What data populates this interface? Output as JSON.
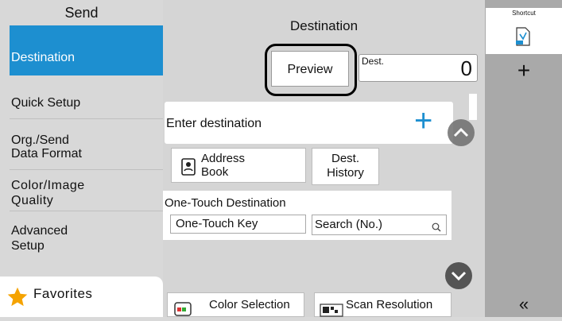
{
  "sidebar": {
    "title": "Send",
    "items": [
      {
        "label": "Destination"
      },
      {
        "label": "Quick Setup"
      },
      {
        "label": "Org./Send\nData Format"
      },
      {
        "label": "Color/Image\nQuality"
      },
      {
        "label": "Advanced\nSetup"
      }
    ],
    "favorites_label": "Favorites"
  },
  "main": {
    "title": "Destination",
    "preview_label": "Preview",
    "dest_label": "Dest.",
    "dest_count": "0",
    "enter_destination": "Enter destination",
    "address_book_label": "Address\nBook",
    "dest_history_label": "Dest.\nHistory",
    "one_touch_title": "One-Touch Destination",
    "one_touch_key": "One-Touch Key",
    "search_no": "Search (No.)",
    "color_selection": "Color Selection",
    "scan_resolution": "Scan Resolution"
  },
  "rightbar": {
    "shortcut_label": "Shortcut",
    "add_symbol": "+",
    "collapse_symbol": "«"
  },
  "colors": {
    "accent": "#1d8fd0",
    "selected_bg": "#1d8fd0",
    "star": "#f5a300"
  }
}
